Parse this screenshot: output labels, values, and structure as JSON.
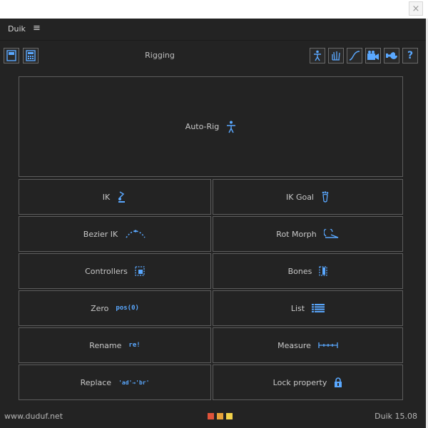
{
  "window": {
    "close_glyph": "×"
  },
  "header": {
    "app_name": "Duik",
    "menu_glyph": "≡"
  },
  "toolbar": {
    "title": "Rigging",
    "left_icons": [
      "calculator-icon",
      "keypad-icon"
    ],
    "right_icons": [
      "rigging-icon",
      "hand-icon",
      "curve-icon",
      "camera-icon",
      "wrench-icon",
      "help-icon"
    ],
    "help_glyph": "?"
  },
  "buttons": {
    "auto_rig": "Auto-Rig",
    "ik": "IK",
    "ik_goal": "IK Goal",
    "bezier_ik": "Bezier IK",
    "rot_morph": "Rot Morph",
    "controllers": "Controllers",
    "bones": "Bones",
    "zero": "Zero",
    "zero_icon_text": "pos(0)",
    "list": "List",
    "rename": "Rename",
    "rename_icon_text": "re!",
    "measure": "Measure",
    "replace": "Replace",
    "replace_icon_text": "'ad'→'br'",
    "lock_property": "Lock property"
  },
  "footer": {
    "url": "www.duduf.net",
    "version": "Duik 15.08",
    "status_colors": [
      "#e0533a",
      "#e8a23a",
      "#f2d24a"
    ]
  },
  "colors": {
    "accent": "#5aa8ff",
    "panel_bg": "#232323",
    "border": "#5d5d5d"
  }
}
